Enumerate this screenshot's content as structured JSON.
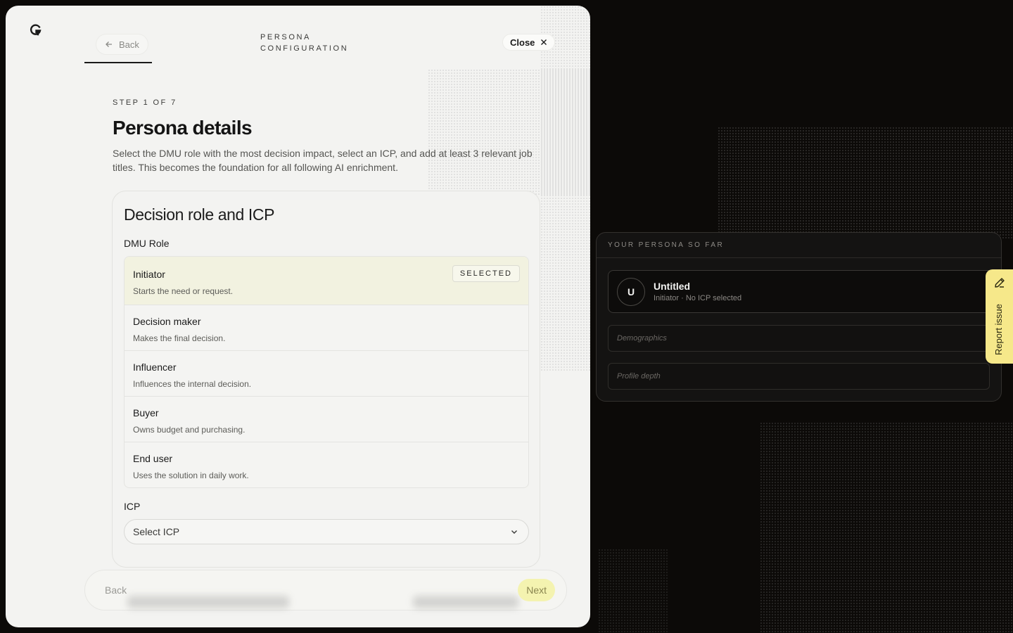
{
  "header": {
    "back_label": "Back",
    "title_line1": "PERSONA",
    "title_line2": "CONFIGURATION",
    "close_label": "Close"
  },
  "step": {
    "label": "STEP 1 OF 7",
    "title": "Persona details",
    "description": "Select the DMU role with the most decision impact, select an ICP, and add at least 3 relevant job titles. This becomes the foundation for all following AI enrichment."
  },
  "card": {
    "title": "Decision role and ICP",
    "dmu_label": "DMU Role",
    "selected_badge": "SELECTED",
    "roles": [
      {
        "name": "Initiator",
        "desc": "Starts the need or request."
      },
      {
        "name": "Decision maker",
        "desc": "Makes the final decision."
      },
      {
        "name": "Influencer",
        "desc": "Influences the internal decision."
      },
      {
        "name": "Buyer",
        "desc": "Owns budget and purchasing."
      },
      {
        "name": "End user",
        "desc": "Uses the solution in daily work."
      }
    ],
    "icp_label": "ICP",
    "icp_placeholder": "Select ICP"
  },
  "footer": {
    "back_label": "Back",
    "next_label": "Next"
  },
  "summary": {
    "heading": "YOUR PERSONA SO FAR",
    "avatar_letter": "U",
    "persona_name": "Untitled",
    "persona_sub": "Initiator · No ICP selected",
    "demographics": "Demographics",
    "profile_depth": "Profile depth"
  },
  "report": {
    "label": "Report issue"
  },
  "colors": {
    "selected_bg": "#f2f2e0",
    "next_bg": "#f4f3b0",
    "report_bg": "#f6e88a",
    "dark_bg": "#0c0a08"
  }
}
